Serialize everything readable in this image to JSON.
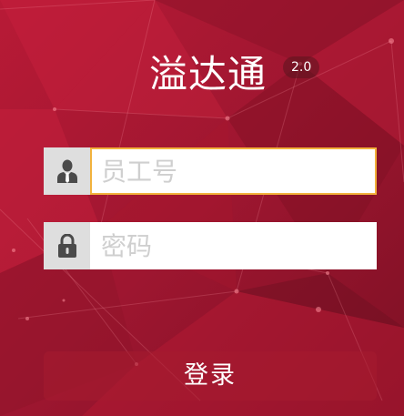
{
  "app": {
    "title": "溢达通",
    "version": "2.0"
  },
  "form": {
    "employee_id": {
      "placeholder": "员工号",
      "value": "",
      "icon": "user-icon"
    },
    "password": {
      "placeholder": "密码",
      "value": "",
      "icon": "lock-icon"
    },
    "login_label": "登录"
  },
  "colors": {
    "background": "#a5172f",
    "focus_border": "#f2b23c",
    "icon_box": "#dedede"
  }
}
